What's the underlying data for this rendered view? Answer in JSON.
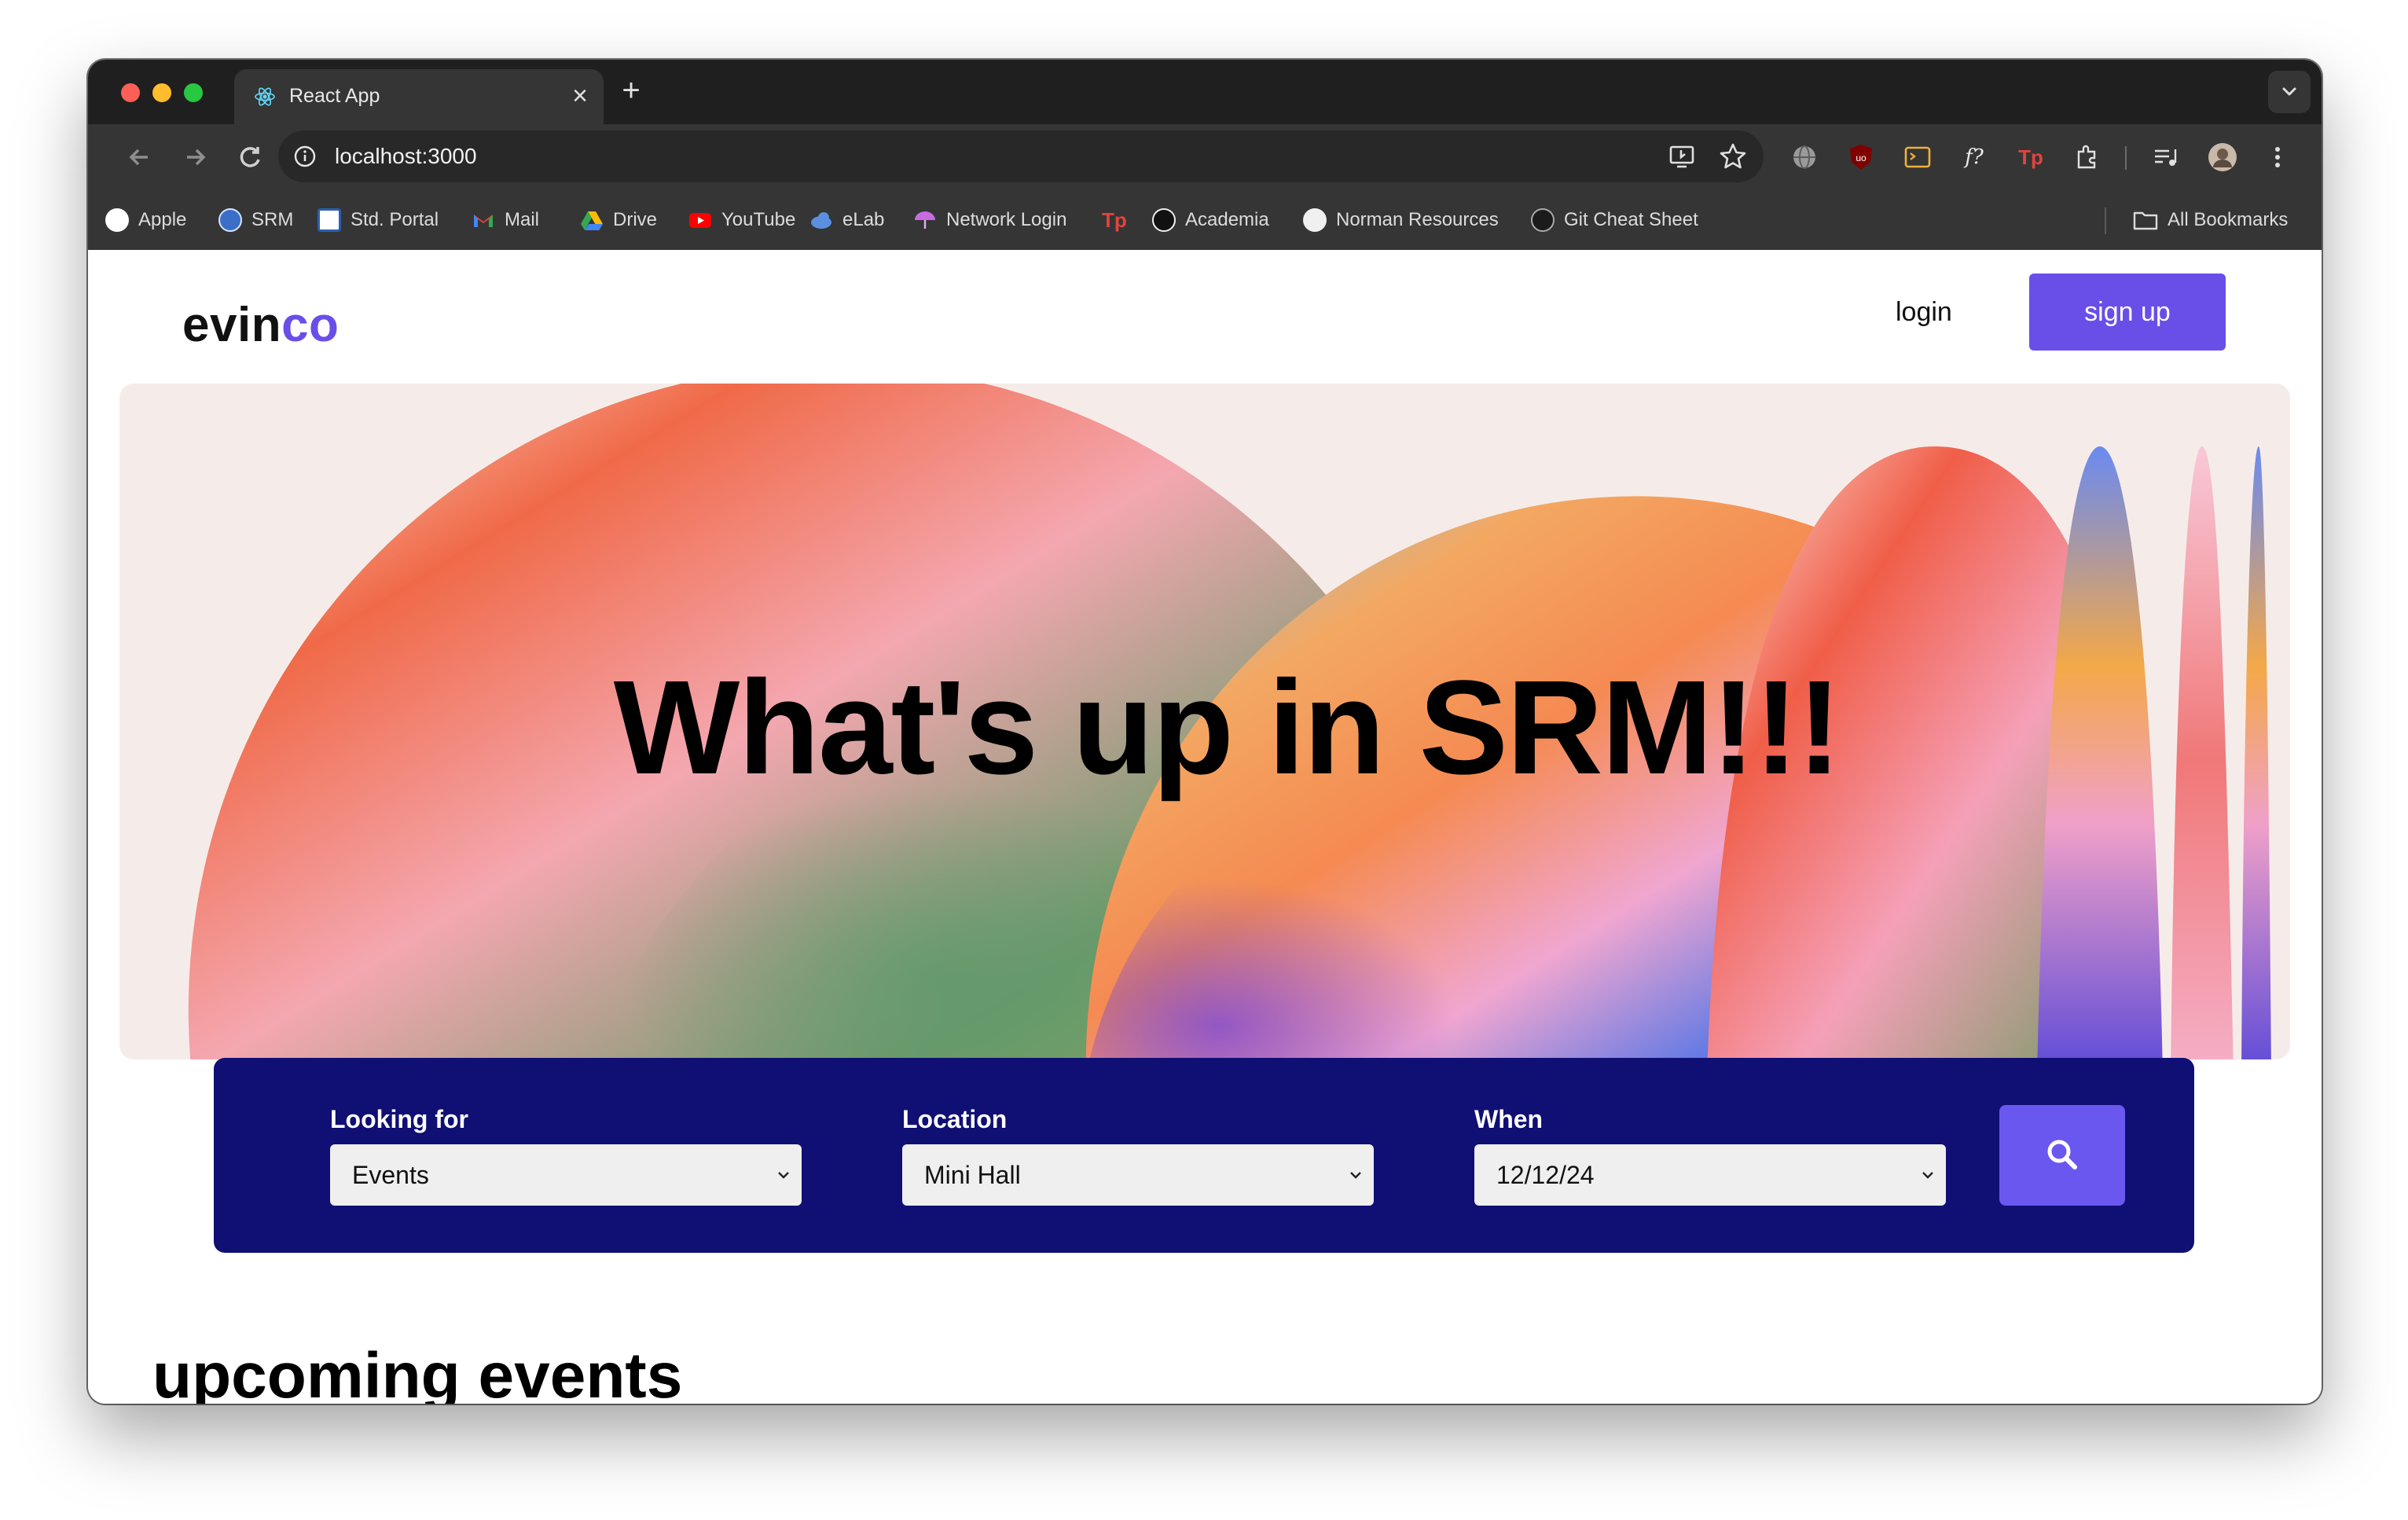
{
  "browser": {
    "tab_title": "React App",
    "url": "localhost:3000",
    "bookmarks": [
      {
        "label": "Apple",
        "icon": "apple-icon"
      },
      {
        "label": "SRM",
        "icon": "srm-icon"
      },
      {
        "label": "Std. Portal",
        "icon": "portal-icon"
      },
      {
        "label": "Mail",
        "icon": "gmail-icon"
      },
      {
        "label": "Drive",
        "icon": "drive-icon"
      },
      {
        "label": "YouTube",
        "icon": "youtube-icon"
      },
      {
        "label": "eLab",
        "icon": "elab-icon"
      },
      {
        "label": "Network Login",
        "icon": "umbrella-icon"
      },
      {
        "label": "",
        "icon": "tp-icon"
      },
      {
        "label": "Academia",
        "icon": "academia-icon"
      },
      {
        "label": "Norman Resources",
        "icon": "github-icon"
      },
      {
        "label": "Git Cheat Sheet",
        "icon": "github-icon"
      }
    ],
    "all_bookmarks": "All Bookmarks"
  },
  "header": {
    "logo_main": "evin",
    "logo_accent": "co",
    "login": "login",
    "signup": "sign up"
  },
  "hero": {
    "title": "What's up in SRM!!!"
  },
  "search": {
    "looking_for_label": "Looking for",
    "looking_for_value": "Events",
    "location_label": "Location",
    "location_value": "Mini Hall",
    "when_label": "When",
    "when_value": "12/12/24"
  },
  "section": {
    "title": "upcoming events"
  },
  "colors": {
    "accent": "#6a4ee8",
    "panel": "#100f74",
    "hero_bg": "#f5ece9"
  }
}
